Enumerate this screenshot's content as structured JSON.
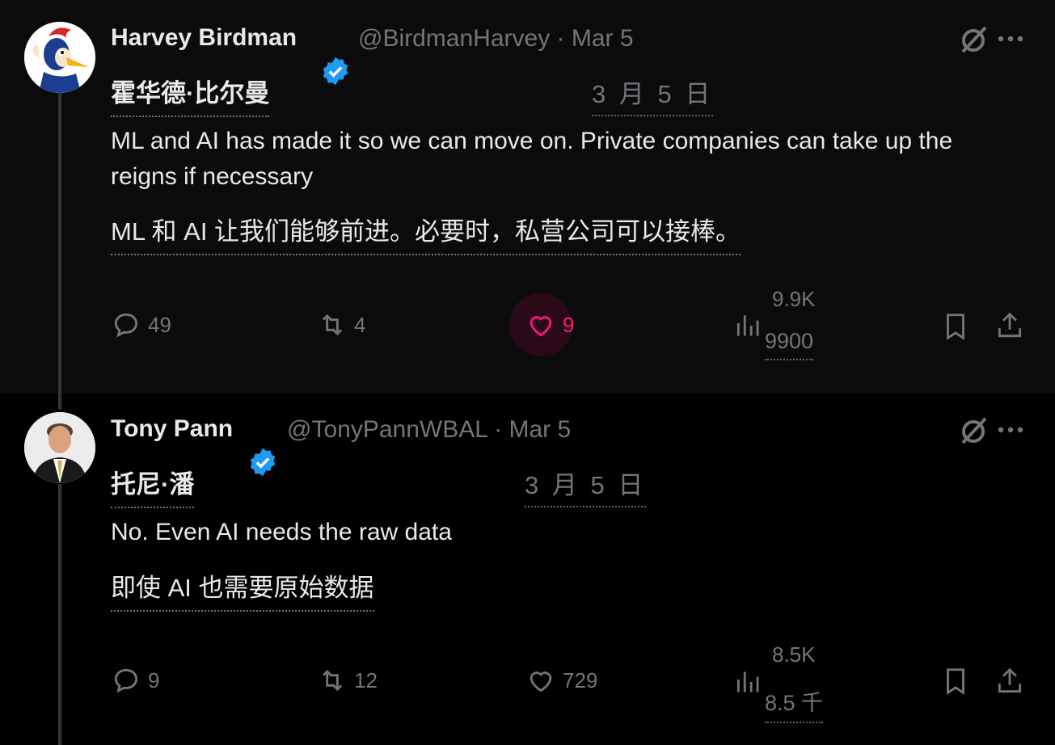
{
  "tweets": [
    {
      "name": "Harvey Birdman",
      "name_zh": "霍华德·比尔曼",
      "handle": "@BirdmanHarvey · Mar 5",
      "date_zh": "3 月 5 日",
      "text": "ML and AI has made it so we can move on. Private companies can take up the reigns if necessary",
      "text_zh": "ML 和 AI 让我们能够前进。必要时，私营公司可以接棒。",
      "replies": "49",
      "retweets": "4",
      "likes": "9",
      "liked": true,
      "views": "9.9K",
      "views_translated": "9900"
    },
    {
      "name": "Tony Pann",
      "name_zh": "托尼·潘",
      "handle": "@TonyPannWBAL · Mar 5",
      "date_zh": "3 月 5 日",
      "text": "No. Even AI needs the raw data",
      "text_zh": "即使 AI 也需要原始数据",
      "replies": "9",
      "retweets": "12",
      "likes": "729",
      "liked": false,
      "views": "8.5K",
      "views_translated": "8.5 千"
    }
  ],
  "icons": {
    "verified": "verified-badge-icon",
    "grok": "grok-icon",
    "more": "more-icon",
    "reply": "reply-icon",
    "retweet": "retweet-icon",
    "like": "heart-icon",
    "views": "views-icon",
    "bookmark": "bookmark-icon",
    "share": "share-icon"
  },
  "colors": {
    "background": "#000000",
    "verified": "#1d9bf0",
    "like_active": "#f91880",
    "muted": "#71767b"
  }
}
